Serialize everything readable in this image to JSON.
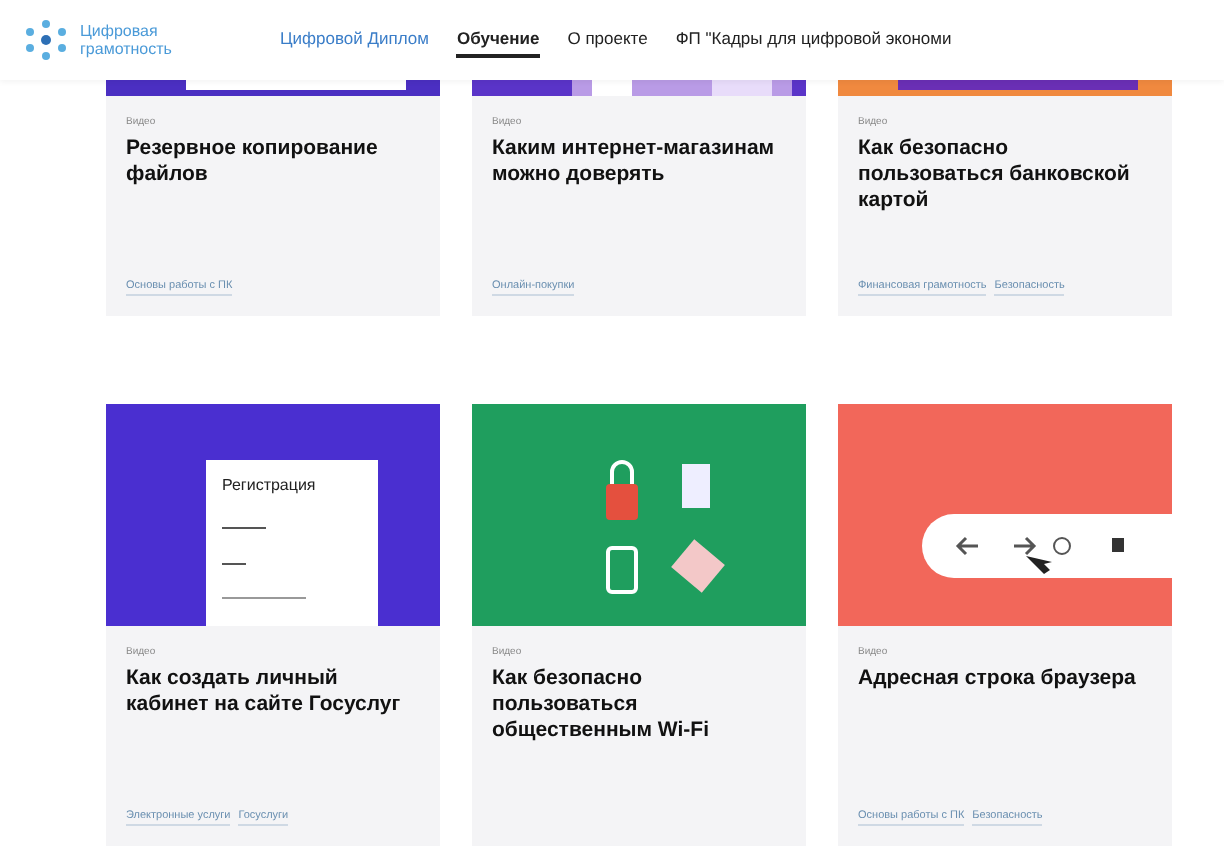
{
  "header": {
    "logo_text": "Цифровая грамотность",
    "nav": [
      {
        "label": "Цифровой Диплом",
        "kind": "accent",
        "selected": false
      },
      {
        "label": "Обучение",
        "kind": "plain",
        "selected": true
      },
      {
        "label": "О проекте",
        "kind": "plain",
        "selected": false
      },
      {
        "label": "ФП \"Кадры для цифровой экономи",
        "kind": "plain",
        "selected": false
      }
    ]
  },
  "cards": [
    {
      "kind": "form",
      "category": "Видео",
      "title": "Резервное копирование файлов",
      "tags": [
        "Основы работы с ПК"
      ]
    },
    {
      "kind": "shapes",
      "category": "Видео",
      "title": "Каким интернет-магазинам можно доверять",
      "tags": [
        "Онлайн-покупки"
      ]
    },
    {
      "kind": "bar",
      "category": "Видео",
      "title": "Как безопасно пользоваться банковской картой",
      "tags": [
        "Финансовая грамотность",
        "Безопасность"
      ]
    },
    {
      "kind": "registration",
      "category": "Видео",
      "title": "Как создать личный кабинет на сайте Госуслуг",
      "tags": [
        "Электронные услуги",
        "Госуслуги"
      ],
      "image_text": "Регистрация"
    },
    {
      "kind": "wifi",
      "category": "Видео",
      "title": "Как безопасно пользоваться общественным Wi-Fi"
    },
    {
      "kind": "browser",
      "category": "Видео",
      "title": "Адресная строка браузера",
      "tags": [
        "Основы работы с ПК",
        "Безопасность"
      ]
    }
  ]
}
